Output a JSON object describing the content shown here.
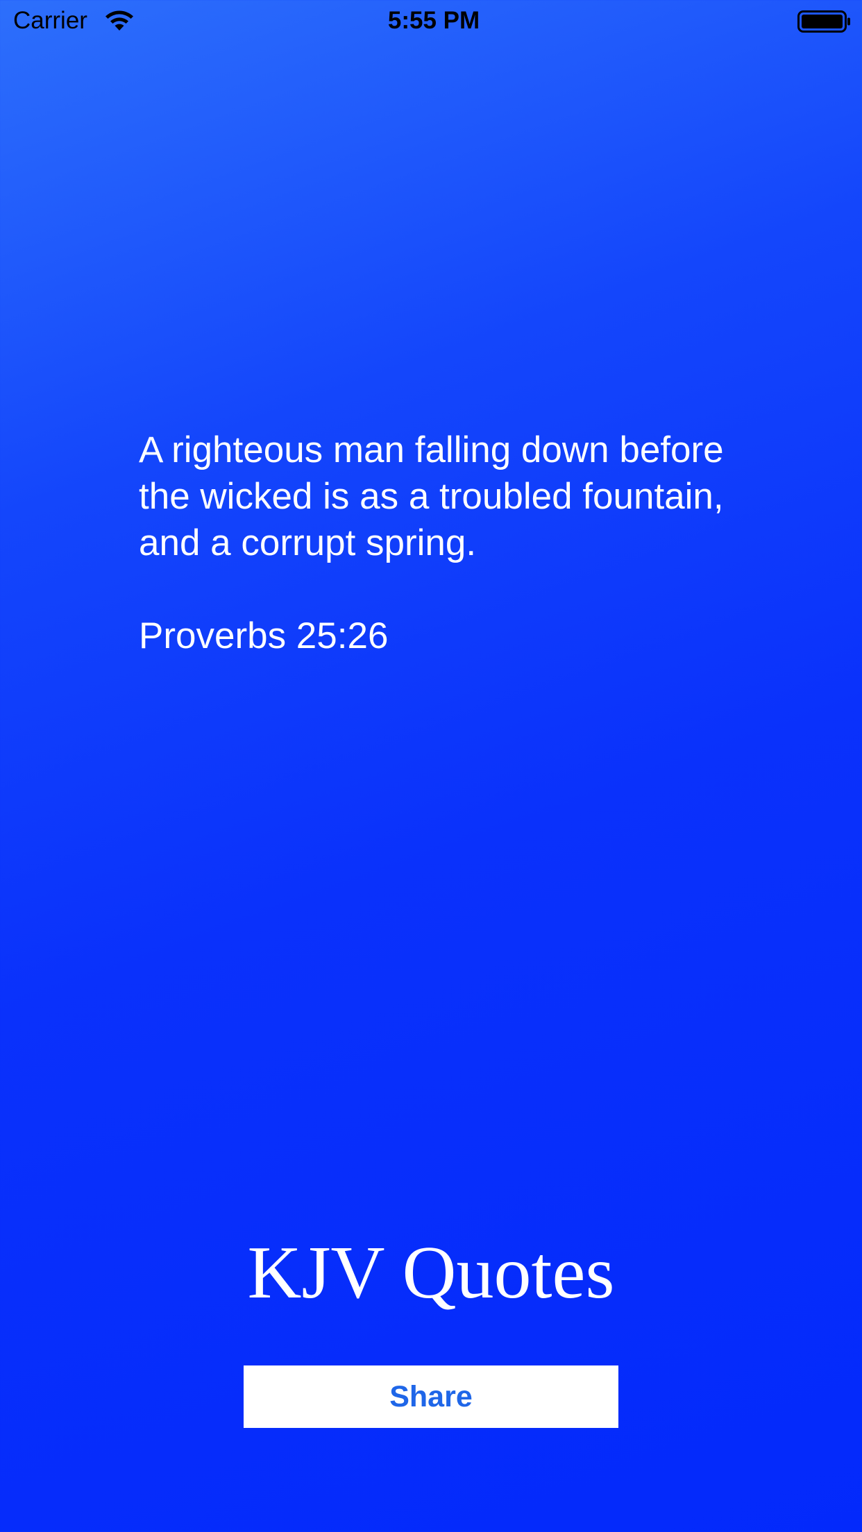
{
  "status_bar": {
    "carrier": "Carrier",
    "time": "5:55 PM",
    "wifi_icon": "wifi-icon",
    "battery_icon": "battery-icon"
  },
  "quote": {
    "text": "A righteous man falling down before the wicked is as a troubled fountain, and a corrupt spring.",
    "reference": "Proverbs 25:26"
  },
  "app": {
    "title": "KJV Quotes"
  },
  "share_button": {
    "label": "Share"
  },
  "colors": {
    "background_top": "#2d6ffb",
    "background_bottom": "#0329fb",
    "text": "#ffffff",
    "button_background": "#ffffff",
    "button_text": "#1f66e8",
    "status_text": "#000000"
  }
}
